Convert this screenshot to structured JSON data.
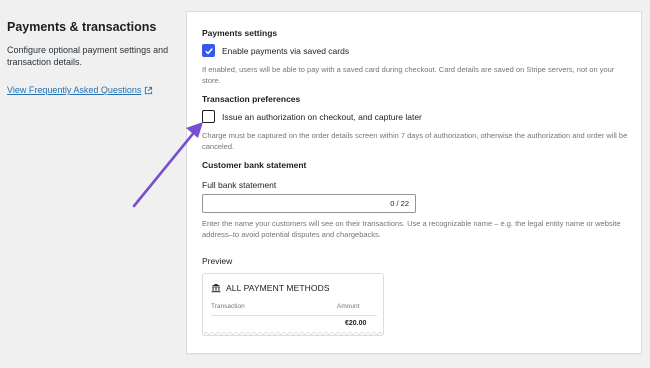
{
  "section": {
    "title": "Payments & transactions",
    "description": "Configure optional payment settings and transaction details.",
    "faq_link": "View Frequently Asked Questions"
  },
  "payments_settings": {
    "title": "Payments settings",
    "saved_cards_label": "Enable payments via saved cards",
    "saved_cards_checked": true,
    "saved_cards_help": "If enabled, users will be able to pay with a saved card during checkout. Card details are saved on Stripe servers, not on your store."
  },
  "transaction_preferences": {
    "title": "Transaction preferences",
    "authorize_label": "Issue an authorization on checkout, and capture later",
    "authorize_checked": false,
    "authorize_help": "Charge must be captured on the order details screen within 7 days of authorization, otherwise the authorization and order will be canceled."
  },
  "bank_statement": {
    "title": "Customer bank statement",
    "field_label": "Full bank statement",
    "value": "",
    "counter": "0 / 22",
    "help": "Enter the name your customers will see on their transactions. Use a recognizable name – e.g. the legal entity name or website address–to avoid potential disputes and chargebacks."
  },
  "preview": {
    "label": "Preview",
    "heading": "ALL PAYMENT METHODS",
    "col_transaction": "Transaction",
    "col_amount": "Amount",
    "amount": "€20.00"
  },
  "colors": {
    "accent": "#3858e9",
    "annotation_arrow": "#7a4ed0",
    "link": "#2271b1"
  }
}
